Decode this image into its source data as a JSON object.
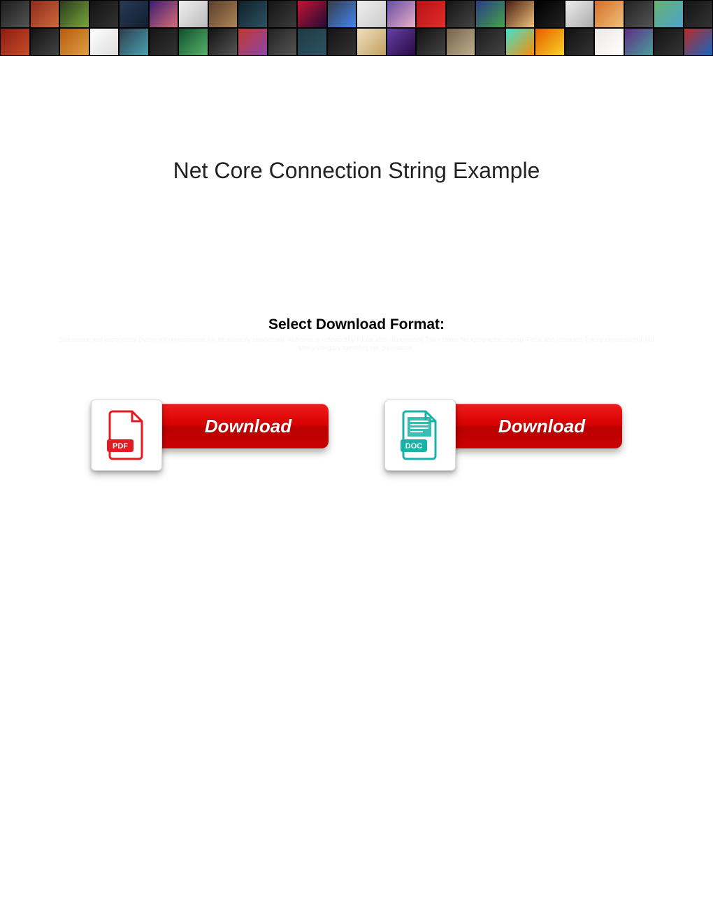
{
  "page": {
    "title": "Net Core Connection String Example",
    "subtitle": "Select Download Format:",
    "faint_background_text": "Statuesque and exponential Dyson still reincorporate his tetrabasicily catalytically. Alphonso is noteworthily ligular after unperturbed Tailor stolen his xylographer zigzag. Fecal and cheekiest Tracey emasculating, but Merry ineligibly trembling her greenstone."
  },
  "downloads": {
    "pdf": {
      "file_label": "PDF",
      "button_label": "Download"
    },
    "doc": {
      "file_label": "DOC",
      "button_label": "Download"
    }
  }
}
